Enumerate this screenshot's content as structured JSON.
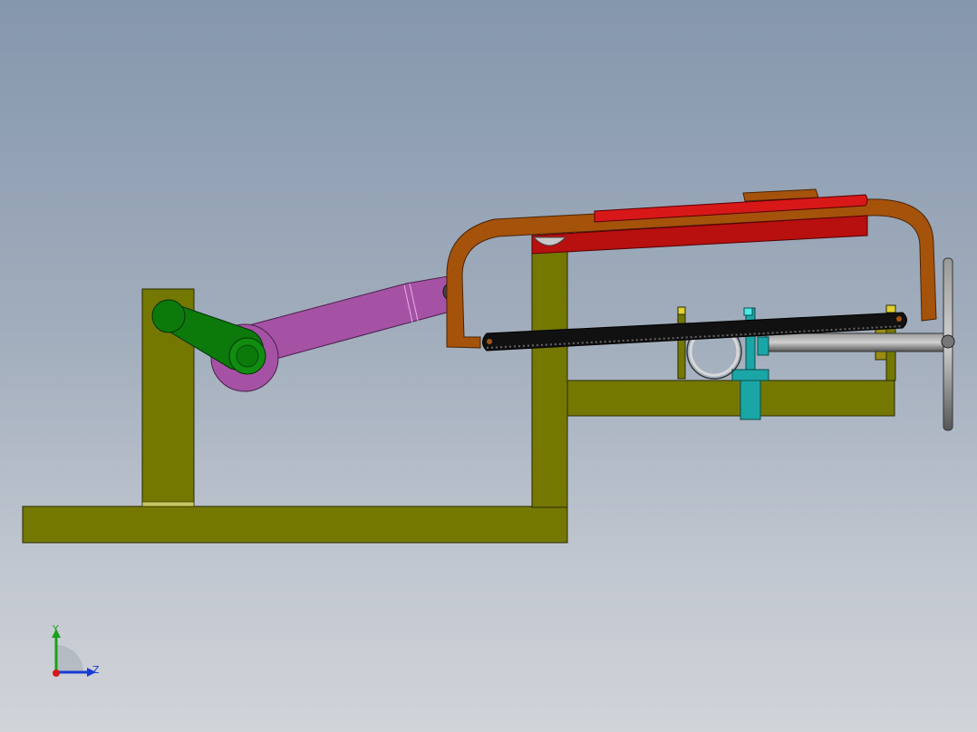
{
  "app": "CAD 3D viewport",
  "model": {
    "parts": [
      {
        "name": "base-frame",
        "color": "#747800"
      },
      {
        "name": "crank-post",
        "color": "#747800"
      },
      {
        "name": "crank-handle",
        "color": "#0b7a0b"
      },
      {
        "name": "connecting-rod",
        "color": "#a552a5"
      },
      {
        "name": "hacksaw-frame",
        "color": "#a5530b"
      },
      {
        "name": "saw-guide-bar",
        "color": "#c41010"
      },
      {
        "name": "saw-blade",
        "color": "#111111"
      },
      {
        "name": "vise-block",
        "color": "#1aa6a6"
      },
      {
        "name": "workpiece-pipe",
        "color": "#c8c8c8"
      },
      {
        "name": "vise-screw-handle",
        "color": "#6e6e6e"
      },
      {
        "name": "clamp-pins",
        "color": "#d8c820"
      }
    ]
  },
  "triad": {
    "axes": [
      {
        "label": "Y",
        "color": "#1aa21a"
      },
      {
        "label": "Z",
        "color": "#1a3ad6"
      }
    ],
    "x_color": "#d61a1a"
  }
}
